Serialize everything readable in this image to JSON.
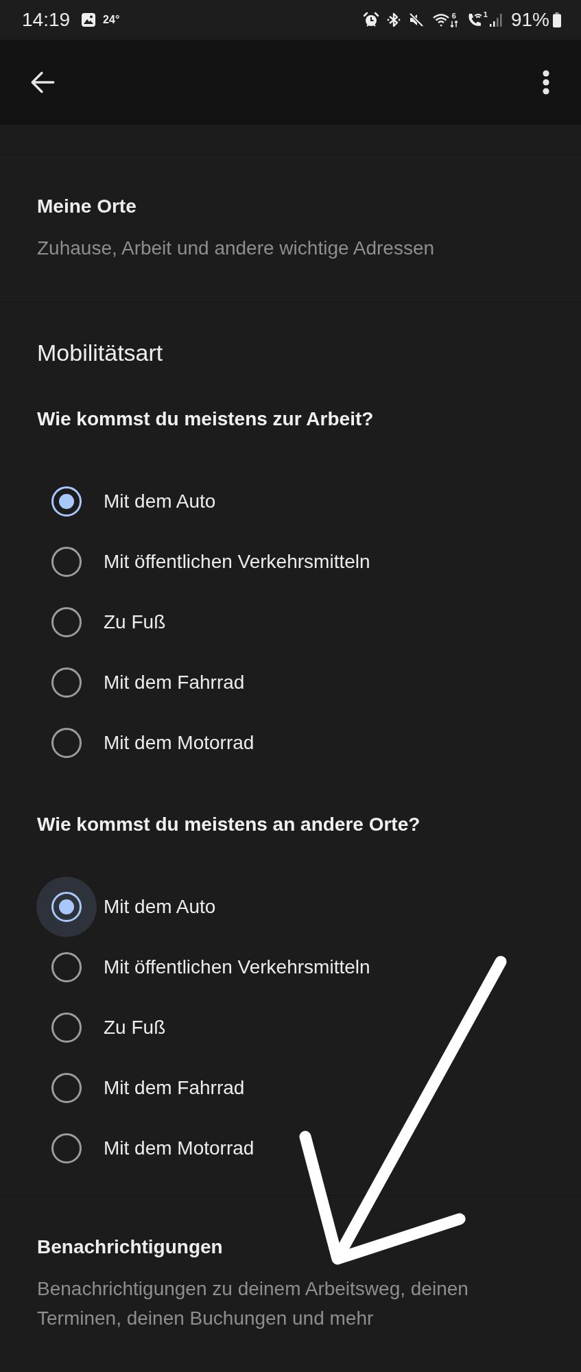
{
  "status_bar": {
    "time": "14:19",
    "temperature": "24°",
    "wifi_label": "6",
    "sim_label": "1",
    "battery": "91%"
  },
  "sections": [
    {
      "kind": "link",
      "title": "Meine Orte",
      "subtitle": "Zuhause, Arbeit und andere wichtige Adressen"
    },
    {
      "kind": "choice",
      "title": "Mobilitätsart",
      "groups": [
        {
          "question": "Wie kommst du meistens zur Arbeit?",
          "options": [
            {
              "label": "Mit dem Auto",
              "selected": true,
              "focused": false
            },
            {
              "label": "Mit öffentlichen Verkehrsmitteln",
              "selected": false,
              "focused": false
            },
            {
              "label": "Zu Fuß",
              "selected": false,
              "focused": false
            },
            {
              "label": "Mit dem Fahrrad",
              "selected": false,
              "focused": false
            },
            {
              "label": "Mit dem Motorrad",
              "selected": false,
              "focused": false
            }
          ]
        },
        {
          "question": "Wie kommst du meistens an andere Orte?",
          "options": [
            {
              "label": "Mit dem Auto",
              "selected": true,
              "focused": true
            },
            {
              "label": "Mit öffentlichen Verkehrsmitteln",
              "selected": false,
              "focused": false
            },
            {
              "label": "Zu Fuß",
              "selected": false,
              "focused": false
            },
            {
              "label": "Mit dem Fahrrad",
              "selected": false,
              "focused": false
            },
            {
              "label": "Mit dem Motorrad",
              "selected": false,
              "focused": false
            }
          ]
        }
      ]
    },
    {
      "kind": "link",
      "title": "Benachrichtigungen",
      "subtitle": "Benachrichtigungen zu deinem Arbeitsweg, deinen Terminen, deinen Buchungen und mehr"
    }
  ],
  "annotations": [
    {
      "kind": "arrow"
    }
  ]
}
